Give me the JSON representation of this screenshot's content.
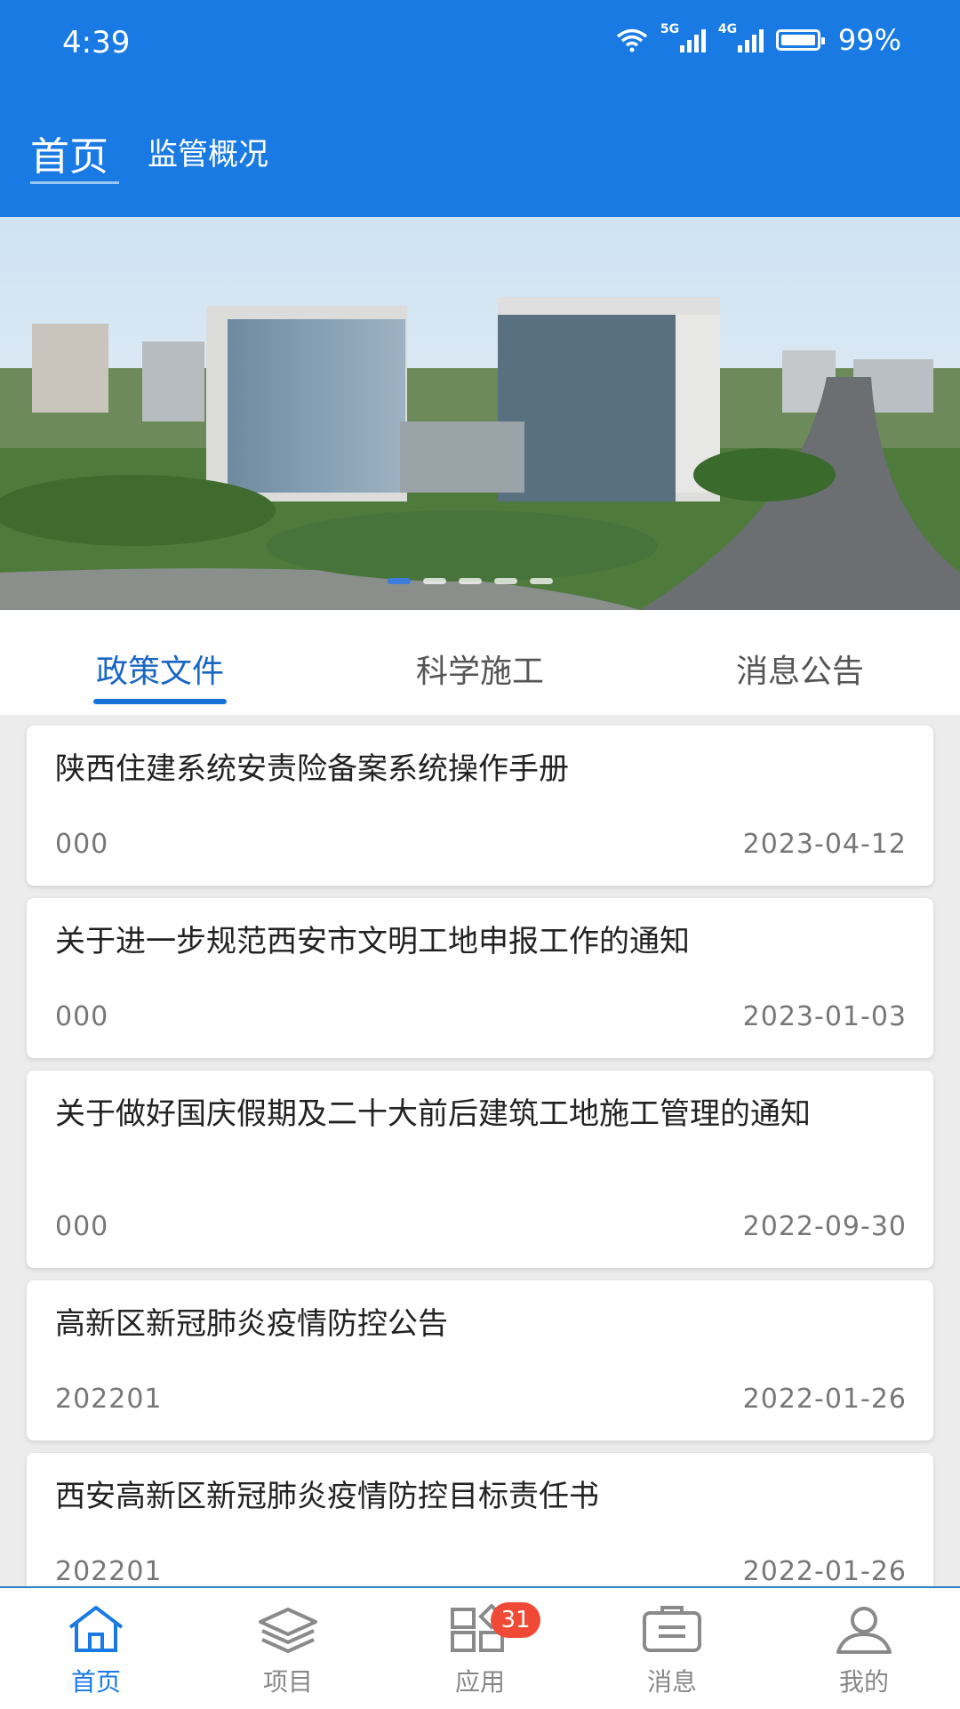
{
  "status_bar": {
    "time": "4:39",
    "signal1": "5G",
    "signal2": "4G",
    "battery": "99%"
  },
  "header": {
    "title": "首页",
    "subtitle": "监管概况"
  },
  "colors": {
    "brand": "#1a7ae3",
    "tab_active": "#1a66c4",
    "badge": "#f04a36"
  },
  "banner": {
    "image_desc": "city-buildings-photo",
    "slides": 5,
    "active_slide": 0
  },
  "tabs": [
    {
      "label": "政策文件",
      "active": true
    },
    {
      "label": "科学施工",
      "active": false
    },
    {
      "label": "消息公告",
      "active": false
    }
  ],
  "documents": [
    {
      "title": "陕西住建系统安责险备案系统操作手册",
      "code": "000",
      "date": "2023-04-12"
    },
    {
      "title": "关于进一步规范西安市文明工地申报工作的通知",
      "code": "000",
      "date": "2023-01-03"
    },
    {
      "title": "关于做好国庆假期及二十大前后建筑工地施工管理的通知",
      "code": "000",
      "date": "2022-09-30"
    },
    {
      "title": "高新区新冠肺炎疫情防控公告",
      "code": "202201",
      "date": "2022-01-26"
    },
    {
      "title": "西安高新区新冠肺炎疫情防控目标责任书",
      "code": "202201",
      "date": "2022-01-26"
    }
  ],
  "bottom_nav": [
    {
      "label": "首页",
      "icon": "home-icon",
      "active": true
    },
    {
      "label": "项目",
      "icon": "layers-icon",
      "active": false
    },
    {
      "label": "应用",
      "icon": "apps-icon",
      "active": false,
      "badge": "31"
    },
    {
      "label": "消息",
      "icon": "message-icon",
      "active": false
    },
    {
      "label": "我的",
      "icon": "profile-icon",
      "active": false
    }
  ]
}
